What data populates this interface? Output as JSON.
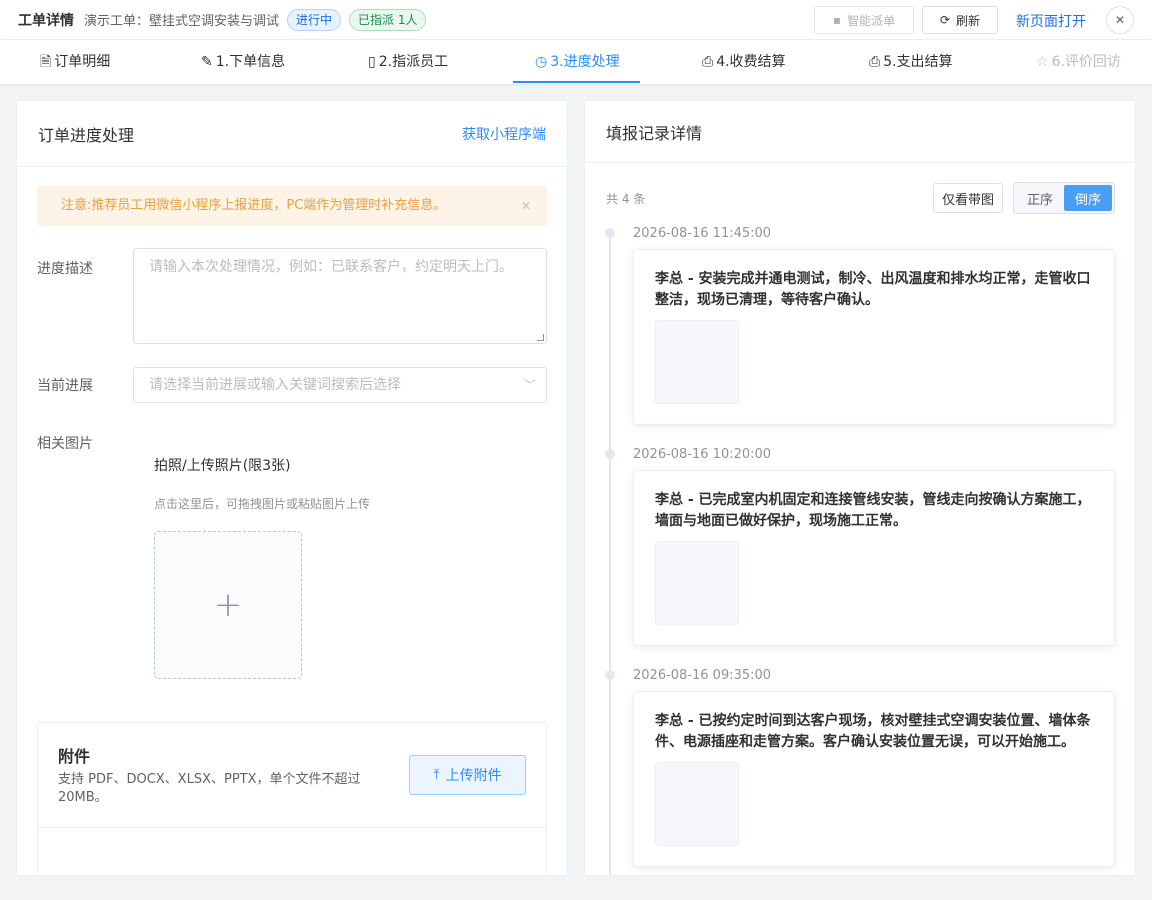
{
  "topbar": {
    "title": "工单详情",
    "subtitle": "演示工单：壁挂式空调安装与调试",
    "status_tag": "进行中",
    "assign_tag": "已指派 1人",
    "smart_dispatch_label": "智能派单",
    "refresh_label": "刷新",
    "new_page_label": "新页面打开",
    "close_icon": "close-icon"
  },
  "tabs": [
    {
      "label": "订单明细",
      "icon": "document-icon"
    },
    {
      "label": "1.下单信息",
      "icon": "pen-icon"
    },
    {
      "label": "2.指派员工",
      "icon": "tablet-icon"
    },
    {
      "label": "3.进度处理",
      "icon": "clock-icon"
    },
    {
      "label": "4.收费结算",
      "icon": "printer-icon"
    },
    {
      "label": "5.支出结算",
      "icon": "printer-icon"
    },
    {
      "label": "6.评价回访",
      "icon": "star-icon"
    }
  ],
  "active_tab": "3.进度处理",
  "left_panel": {
    "title": "订单进度处理",
    "mini_program_link": "获取小程序端",
    "notice": "注意:推荐员工用微信小程序上报进度，PC端作为管理时补充信息。",
    "progress_desc_label": "进度描述",
    "progress_desc_placeholder": "请输入本次处理情况，例如：已联系客户，约定明天上门。",
    "current_progress_label": "当前进展",
    "current_progress_placeholder": "请选择当前进展或输入关键词搜索后选择",
    "images_label": "相关图片",
    "upload_title": "拍照/上传照片(限3张)",
    "upload_hint": "点击这里后，可拖拽图片或粘贴图片上传",
    "attachment": {
      "title": "附件",
      "desc": "支持 PDF、DOCX、XLSX、PPTX，单个文件不超过 20MB。",
      "upload_button": "上传附件"
    }
  },
  "right_panel": {
    "title": "填报记录详情",
    "count": "共 4 条",
    "only_images_button": "仅看带图",
    "sort_asc": "正序",
    "sort_desc": "倒序",
    "active_sort": "倒序",
    "records": [
      {
        "time": "2026-08-16 11:45:00",
        "text": "李总 - 安装完成并通电测试，制冷、出风温度和排水均正常，走管收口整洁，现场已清理，等待客户确认。"
      },
      {
        "time": "2026-08-16 10:20:00",
        "text": "李总 - 已完成室内机固定和连接管线安装，管线走向按确认方案施工，墙面与地面已做好保护，现场施工正常。"
      },
      {
        "time": "2026-08-16 09:35:00",
        "text": "李总 - 已按约定时间到达客户现场，核对壁挂式空调安装位置、墙体条件、电源插座和走管方案。客户确认安装位置无误，可以开始施工。"
      }
    ]
  },
  "colors": {
    "accent": "#2d8cf0",
    "notice_bg": "#fdf3e6",
    "notice_text": "#e6a23c"
  }
}
